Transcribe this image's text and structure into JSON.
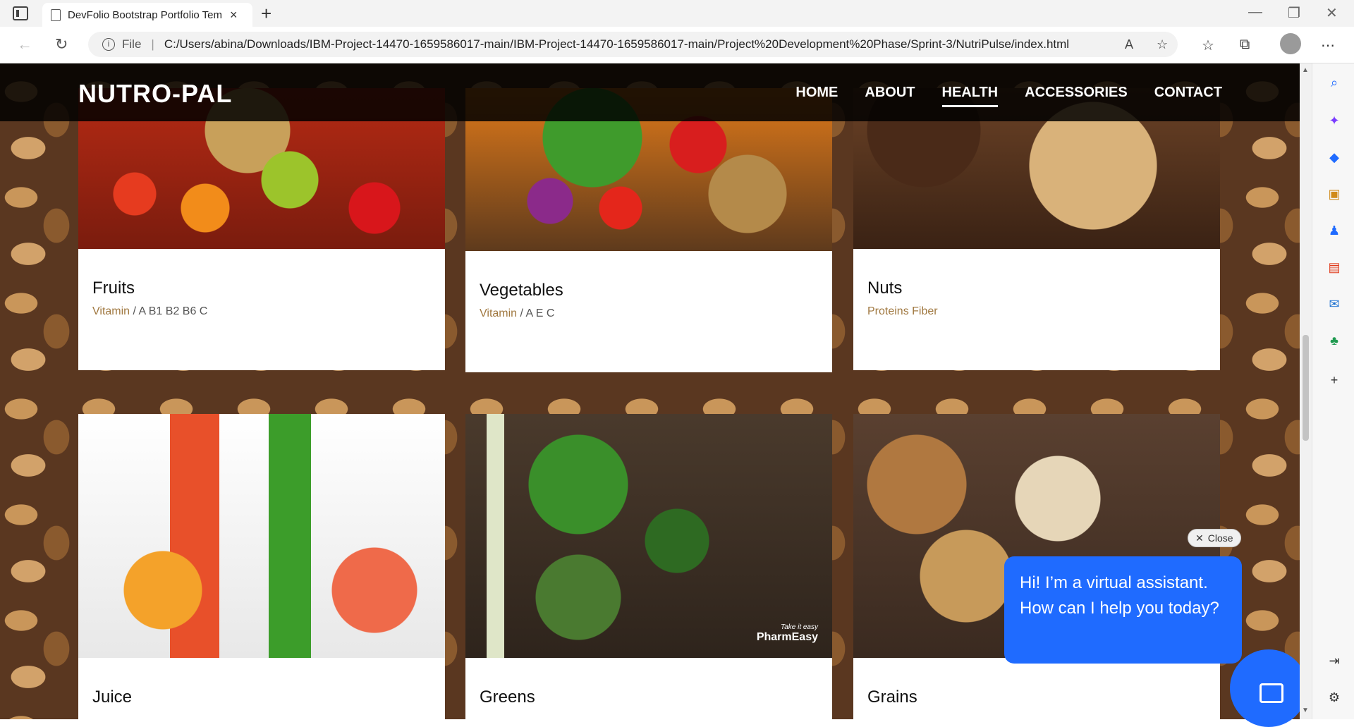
{
  "browser": {
    "tab_title": "DevFolio Bootstrap Portfolio Template",
    "new_tab": "+",
    "address": {
      "file_label": "File",
      "separator": "|",
      "url": "C:/Users/abina/Downloads/IBM-Project-14470-1659586017-main/IBM-Project-14470-1659586017-main/Project%20Development%20Phase/Sprint-3/NutriPulse/index.html"
    }
  },
  "site": {
    "brand": "NUTRO-PAL",
    "menu": [
      "HOME",
      "ABOUT",
      "HEALTH",
      "ACCESSORIES",
      "CONTACT"
    ],
    "active_menu": "HEALTH"
  },
  "cards": [
    {
      "title": "Fruits",
      "category": "Vitamin",
      "detail": " / A B1 B2 B6 C"
    },
    {
      "title": "Vegetables",
      "category": "Vitamin",
      "detail": " / A E C"
    },
    {
      "title": "Nuts",
      "category": "Proteins Fiber",
      "detail": ""
    },
    {
      "title": "Juice",
      "category": "",
      "detail": ""
    },
    {
      "title": "Greens",
      "category": "",
      "detail": ""
    },
    {
      "title": "Grains",
      "category": "",
      "detail": ""
    }
  ],
  "watermark": {
    "small": "Take it easy",
    "brand": "PharmEasy"
  },
  "chat": {
    "close_label": "Close",
    "message": "Hi! I’m a virtual assistant. How can I help you today?"
  },
  "colors": {
    "accent": "#1f6bff",
    "category": "#a07840",
    "navbar": "#000000"
  }
}
